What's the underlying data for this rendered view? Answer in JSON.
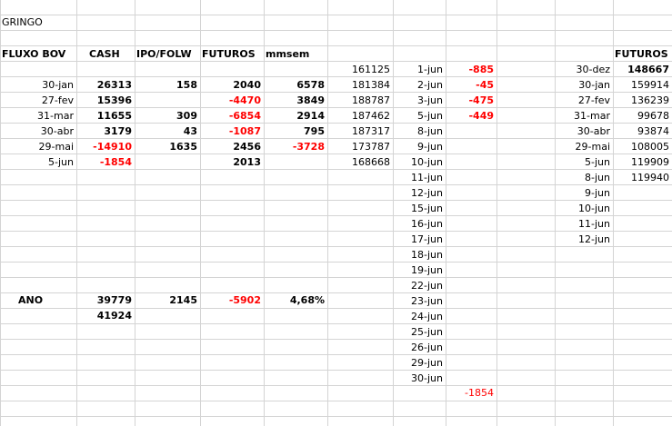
{
  "title": "GRINGO",
  "headers": {
    "fluxo": "FLUXO BOV",
    "cash": "CASH",
    "ipo": "IPO/FOLW",
    "futuros": "FUTUROS",
    "mmsem": "mmsem",
    "futuros_right": "FUTUROS"
  },
  "months": [
    "30-jan",
    "27-fev",
    "31-mar",
    "30-abr",
    "29-mai",
    "5-jun"
  ],
  "cash": [
    "26313",
    "15396",
    "11655",
    "3179",
    "-14910",
    "-1854"
  ],
  "ipo": [
    "158",
    "",
    "309",
    "43",
    "1635",
    ""
  ],
  "futuros": [
    "2040",
    "-4470",
    "-6854",
    "-1087",
    "2456",
    "2013"
  ],
  "mmsem": [
    "6578",
    "3849",
    "2914",
    "795",
    "-3728",
    ""
  ],
  "levels": [
    "161125",
    "181384",
    "188787",
    "187462",
    "187317",
    "173787",
    "168668"
  ],
  "days": [
    "1-jun",
    "2-jun",
    "3-jun",
    "5-jun",
    "8-jun",
    "9-jun",
    "10-jun",
    "11-jun",
    "12-jun",
    "15-jun",
    "16-jun",
    "17-jun",
    "18-jun",
    "19-jun",
    "22-jun",
    "23-jun",
    "24-jun",
    "25-jun",
    "26-jun",
    "29-jun",
    "30-jun"
  ],
  "day_values": [
    "-885",
    "-45",
    "-475",
    "-449"
  ],
  "total": {
    "label": "ANO",
    "cash": "39779",
    "cash2": "41924",
    "ipo": "2145",
    "futuros": "-5902",
    "mmsem": "4,68%"
  },
  "bottom_sum": "-1854",
  "right": {
    "dates": [
      "30-dez",
      "30-jan",
      "27-fev",
      "31-mar",
      "30-abr",
      "29-mai",
      "5-jun",
      "8-jun",
      "9-jun",
      "10-jun",
      "11-jun",
      "12-jun"
    ],
    "values": [
      "148667",
      "159914",
      "136239",
      "99678",
      "93874",
      "108005",
      "119909",
      "119940"
    ]
  },
  "colors": {
    "negative": "#ff0000",
    "gridline": "#d4d4d4"
  }
}
